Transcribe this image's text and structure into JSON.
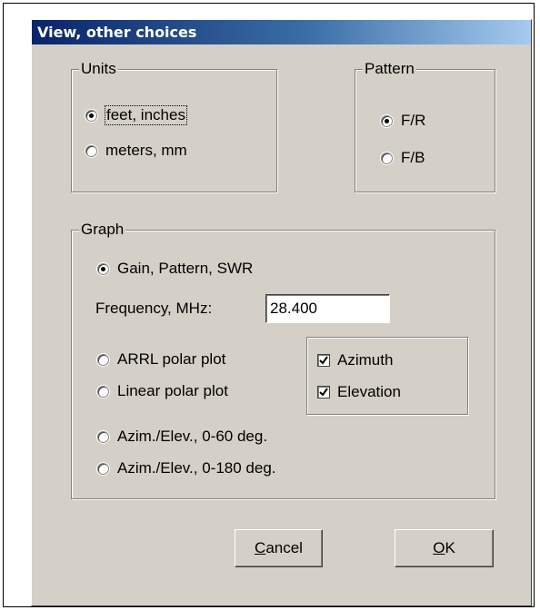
{
  "dialog": {
    "title": "View, other choices"
  },
  "units": {
    "label": "Units",
    "options": [
      {
        "label": "feet, inches",
        "selected": true
      },
      {
        "label": "meters, mm",
        "selected": false
      }
    ]
  },
  "pattern": {
    "label": "Pattern",
    "options": [
      {
        "label": "F/R",
        "selected": true
      },
      {
        "label": "F/B",
        "selected": false
      }
    ]
  },
  "graph": {
    "label": "Graph",
    "options": [
      {
        "label": "Gain, Pattern, SWR",
        "selected": true
      },
      {
        "label": "ARRL polar plot",
        "selected": false
      },
      {
        "label": "Linear polar plot",
        "selected": false
      },
      {
        "label": "Azim./Elev., 0-60 deg.",
        "selected": false
      },
      {
        "label": "Azim./Elev., 0-180 deg.",
        "selected": false
      }
    ],
    "frequency_label": "Frequency, MHz:",
    "frequency_value": "28.400",
    "checks": [
      {
        "label": "Azimuth",
        "checked": true
      },
      {
        "label": "Elevation",
        "checked": true
      }
    ]
  },
  "buttons": {
    "cancel_first": "C",
    "cancel_rest": "ancel",
    "ok_first": "O",
    "ok_rest": "K"
  },
  "colors": {
    "dialog_face": "#d4d0c8",
    "title_start": "#0a246a",
    "title_end": "#a6caf0"
  }
}
